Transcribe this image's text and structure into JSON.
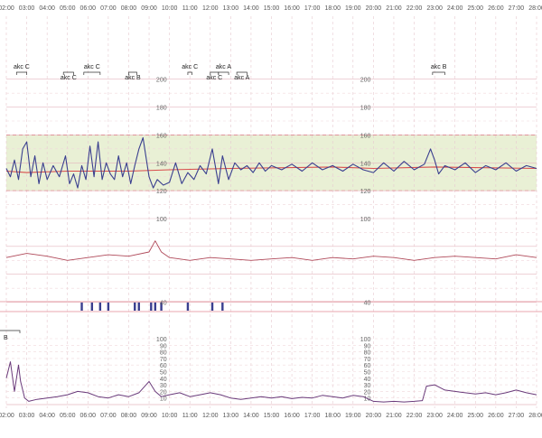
{
  "chart_data": {
    "type": "line",
    "time_labels": [
      "02:00",
      "03:00",
      "04:00",
      "05:00",
      "06:00",
      "07:00",
      "08:00",
      "09:00",
      "10:00",
      "11:00",
      "12:00",
      "13:00",
      "14:00",
      "15:00",
      "16:00",
      "17:00",
      "18:00",
      "19:00",
      "20:00",
      "21:00",
      "22:00",
      "23:00",
      "24:00",
      "25:00",
      "26:00",
      "27:00",
      "28:00"
    ],
    "x_start_hour": 2,
    "x_end_hour": 28,
    "fhr_panel": {
      "y_ticks": [
        40,
        100,
        120,
        140,
        160,
        180,
        200
      ],
      "ylim": [
        30,
        205
      ],
      "normal_band": [
        120,
        160
      ],
      "baseline": [
        [
          2.0,
          134
        ],
        [
          3.0,
          133
        ],
        [
          5.0,
          134
        ],
        [
          8.0,
          134
        ],
        [
          10.0,
          135
        ],
        [
          13.0,
          136
        ],
        [
          18.0,
          137
        ],
        [
          20.0,
          136
        ],
        [
          23.0,
          137
        ],
        [
          28.0,
          136
        ]
      ],
      "fhr_trace": [
        [
          2.0,
          136
        ],
        [
          2.2,
          130
        ],
        [
          2.4,
          142
        ],
        [
          2.6,
          128
        ],
        [
          2.8,
          150
        ],
        [
          3.0,
          155
        ],
        [
          3.2,
          130
        ],
        [
          3.4,
          145
        ],
        [
          3.6,
          125
        ],
        [
          3.8,
          140
        ],
        [
          4.0,
          128
        ],
        [
          4.3,
          138
        ],
        [
          4.6,
          130
        ],
        [
          4.9,
          145
        ],
        [
          5.1,
          125
        ],
        [
          5.3,
          132
        ],
        [
          5.5,
          122
        ],
        [
          5.7,
          138
        ],
        [
          5.9,
          128
        ],
        [
          6.1,
          152
        ],
        [
          6.3,
          130
        ],
        [
          6.5,
          155
        ],
        [
          6.7,
          128
        ],
        [
          6.9,
          140
        ],
        [
          7.1,
          132
        ],
        [
          7.3,
          128
        ],
        [
          7.5,
          145
        ],
        [
          7.7,
          130
        ],
        [
          7.9,
          140
        ],
        [
          8.1,
          125
        ],
        [
          8.3,
          138
        ],
        [
          8.5,
          150
        ],
        [
          8.7,
          158
        ],
        [
          9.0,
          130
        ],
        [
          9.2,
          122
        ],
        [
          9.4,
          128
        ],
        [
          9.7,
          124
        ],
        [
          10.0,
          126
        ],
        [
          10.3,
          140
        ],
        [
          10.6,
          125
        ],
        [
          10.9,
          133
        ],
        [
          11.2,
          128
        ],
        [
          11.5,
          138
        ],
        [
          11.8,
          132
        ],
        [
          12.1,
          150
        ],
        [
          12.4,
          125
        ],
        [
          12.6,
          145
        ],
        [
          12.9,
          128
        ],
        [
          13.2,
          140
        ],
        [
          13.5,
          135
        ],
        [
          13.8,
          138
        ],
        [
          14.1,
          133
        ],
        [
          14.4,
          140
        ],
        [
          14.7,
          134
        ],
        [
          15.0,
          138
        ],
        [
          15.5,
          135
        ],
        [
          16.0,
          139
        ],
        [
          16.5,
          134
        ],
        [
          17.0,
          140
        ],
        [
          17.5,
          135
        ],
        [
          18.0,
          138
        ],
        [
          18.5,
          134
        ],
        [
          19.0,
          139
        ],
        [
          19.5,
          135
        ],
        [
          20.0,
          133
        ],
        [
          20.5,
          140
        ],
        [
          21.0,
          134
        ],
        [
          21.5,
          141
        ],
        [
          22.0,
          135
        ],
        [
          22.5,
          139
        ],
        [
          22.8,
          150
        ],
        [
          23.0,
          142
        ],
        [
          23.2,
          132
        ],
        [
          23.5,
          138
        ],
        [
          24.0,
          135
        ],
        [
          24.5,
          140
        ],
        [
          25.0,
          133
        ],
        [
          25.5,
          138
        ],
        [
          26.0,
          135
        ],
        [
          26.5,
          140
        ],
        [
          27.0,
          134
        ],
        [
          27.5,
          138
        ],
        [
          28.0,
          136
        ]
      ],
      "mhr_trace": [
        [
          2.0,
          72
        ],
        [
          3.0,
          75
        ],
        [
          4.0,
          73
        ],
        [
          5.0,
          70
        ],
        [
          6.0,
          72
        ],
        [
          7.0,
          74
        ],
        [
          8.0,
          73
        ],
        [
          9.0,
          76
        ],
        [
          9.3,
          84
        ],
        [
          9.6,
          76
        ],
        [
          10.0,
          72
        ],
        [
          11.0,
          70
        ],
        [
          12.0,
          72
        ],
        [
          13.0,
          71
        ],
        [
          14.0,
          70
        ],
        [
          15.0,
          71
        ],
        [
          16.0,
          72
        ],
        [
          17.0,
          70
        ],
        [
          18.0,
          72
        ],
        [
          19.0,
          71
        ],
        [
          20.0,
          73
        ],
        [
          21.0,
          72
        ],
        [
          22.0,
          70
        ],
        [
          23.0,
          72
        ],
        [
          24.0,
          73
        ],
        [
          25.0,
          72
        ],
        [
          26.0,
          71
        ],
        [
          27.0,
          74
        ],
        [
          28.0,
          72
        ]
      ],
      "annotations": [
        {
          "label": "akc C",
          "start": 2.5,
          "end": 3.0,
          "row": "upper"
        },
        {
          "label": "akc C",
          "start": 4.8,
          "end": 5.3,
          "row": "lower"
        },
        {
          "label": "akc C",
          "start": 5.8,
          "end": 6.6,
          "row": "upper"
        },
        {
          "label": "akc B",
          "start": 8.0,
          "end": 8.4,
          "row": "lower"
        },
        {
          "label": "akc C",
          "start": 10.9,
          "end": 11.1,
          "row": "upper"
        },
        {
          "label": "akc C",
          "start": 12.0,
          "end": 12.4,
          "row": "lower"
        },
        {
          "label": "akc A",
          "start": 12.4,
          "end": 12.9,
          "row": "upper"
        },
        {
          "label": "akc A",
          "start": 13.3,
          "end": 13.8,
          "row": "lower"
        },
        {
          "label": "akc B",
          "start": 22.9,
          "end": 23.5,
          "row": "upper"
        }
      ],
      "movement_markers": [
        5.7,
        6.2,
        6.6,
        7.0,
        8.3,
        8.5,
        9.1,
        9.3,
        9.6,
        10.9,
        12.1,
        12.6
      ]
    },
    "uc_panel": {
      "y_ticks": [
        10,
        20,
        30,
        40,
        50,
        60,
        70,
        80,
        90,
        100
      ],
      "ylim": [
        0,
        100
      ],
      "partial_label": "B",
      "uc_trace": [
        [
          2.0,
          40
        ],
        [
          2.2,
          65
        ],
        [
          2.4,
          20
        ],
        [
          2.6,
          60
        ],
        [
          2.7,
          35
        ],
        [
          2.9,
          10
        ],
        [
          3.1,
          5
        ],
        [
          3.5,
          8
        ],
        [
          4.0,
          10
        ],
        [
          4.5,
          12
        ],
        [
          5.0,
          15
        ],
        [
          5.5,
          20
        ],
        [
          6.0,
          18
        ],
        [
          6.5,
          12
        ],
        [
          7.0,
          10
        ],
        [
          7.5,
          15
        ],
        [
          8.0,
          12
        ],
        [
          8.5,
          18
        ],
        [
          9.0,
          35
        ],
        [
          9.3,
          20
        ],
        [
          9.6,
          12
        ],
        [
          10.0,
          15
        ],
        [
          10.5,
          18
        ],
        [
          11.0,
          12
        ],
        [
          11.5,
          15
        ],
        [
          12.0,
          18
        ],
        [
          12.5,
          15
        ],
        [
          13.0,
          10
        ],
        [
          13.5,
          8
        ],
        [
          14.0,
          10
        ],
        [
          14.5,
          12
        ],
        [
          15.0,
          10
        ],
        [
          15.5,
          12
        ],
        [
          16.0,
          9
        ],
        [
          16.5,
          11
        ],
        [
          17.0,
          10
        ],
        [
          17.5,
          14
        ],
        [
          18.0,
          12
        ],
        [
          18.5,
          10
        ],
        [
          19.0,
          14
        ],
        [
          19.5,
          12
        ],
        [
          20.0,
          5
        ],
        [
          20.5,
          4
        ],
        [
          21.0,
          5
        ],
        [
          21.5,
          4
        ],
        [
          22.0,
          5
        ],
        [
          22.4,
          6
        ],
        [
          22.6,
          28
        ],
        [
          23.0,
          30
        ],
        [
          23.5,
          22
        ],
        [
          24.0,
          20
        ],
        [
          24.5,
          18
        ],
        [
          25.0,
          16
        ],
        [
          25.5,
          18
        ],
        [
          26.0,
          15
        ],
        [
          26.5,
          18
        ],
        [
          27.0,
          22
        ],
        [
          27.5,
          18
        ],
        [
          28.0,
          15
        ]
      ]
    },
    "colors": {
      "fhr_line": "#3a3f8f",
      "baseline": "#d94c4c",
      "mhr_line": "#b04a5a",
      "normal_band": "#e9f0d5",
      "movement_marker": "#3a3f8f",
      "uc_line": "#6a3a7a"
    }
  }
}
